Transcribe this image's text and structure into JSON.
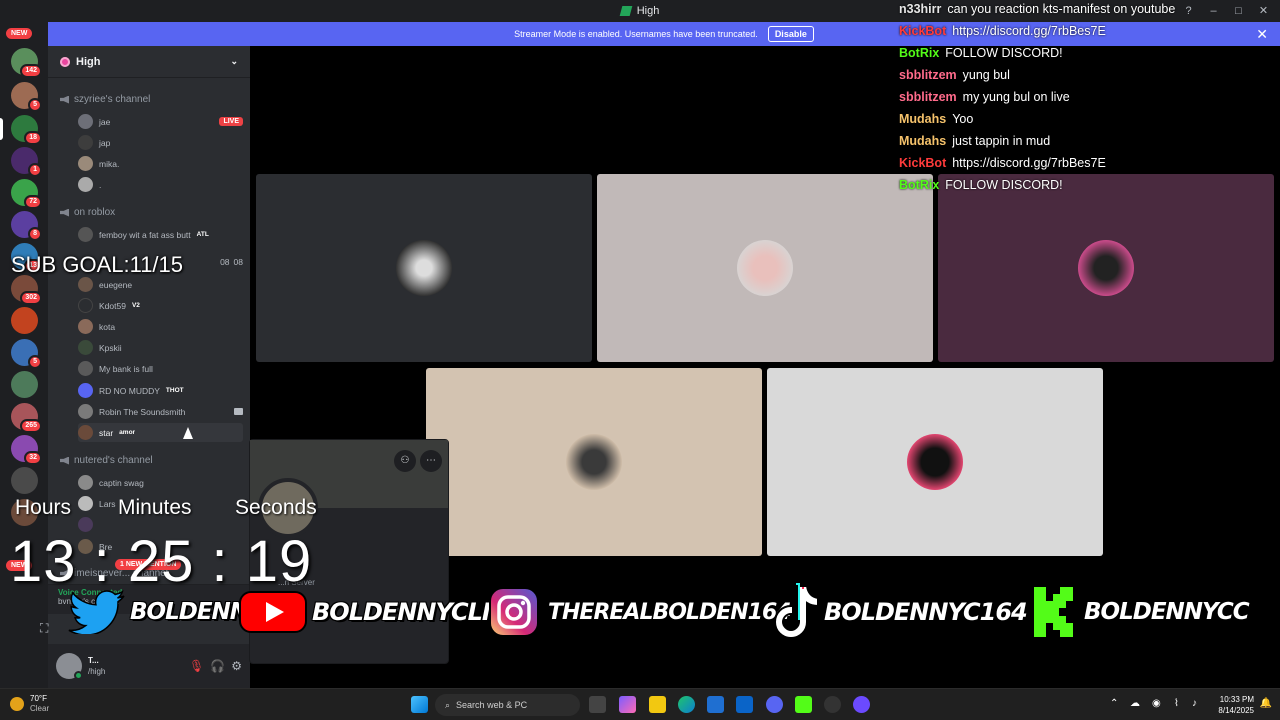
{
  "window": {
    "title": "High"
  },
  "banner": {
    "text": "Streamer Mode is enabled. Usernames have been truncated.",
    "button": "Disable"
  },
  "rail": {
    "new_top": "NEW",
    "badges": [
      "142",
      "5",
      "18",
      "1",
      "72",
      "8",
      "13",
      "302",
      "5",
      "265",
      "32"
    ],
    "new_bottom": "NEW",
    "mention": "1 NEW MENTION"
  },
  "server": {
    "name": "High"
  },
  "channels": {
    "c1": {
      "name": "szyriee's channel",
      "users": [
        "jae",
        "jap",
        "mika.",
        "."
      ],
      "live": "LIVE"
    },
    "c2": {
      "name": "on roblox",
      "users": [
        "femboy wit a fat ass butt"
      ],
      "tag": "ATL"
    },
    "c3": {
      "counts": [
        "08",
        "08"
      ],
      "users": [
        "euegene",
        "Kdot59",
        "kota",
        "Kpskii",
        "My bank is full",
        "RD NO MUDDY",
        "Robin The Soundsmith",
        "star"
      ],
      "tags": {
        "kdot": "V2",
        "rd": "THOT",
        "star": "amor"
      }
    },
    "c4": {
      "name": "nutered's channel",
      "users": [
        "captin swag",
        "Lars",
        "",
        "Bre"
      ]
    },
    "c5": {
      "name": "imeisnever... channel"
    }
  },
  "voice": {
    "status": "Voice Connected",
    "channel": "bvnnyy's chann..."
  },
  "user_panel": {
    "name": "T...",
    "status": "/high"
  },
  "overlay": {
    "sub_goal": "SUB GOAL:11/15",
    "timer_labels": {
      "h": "Hours",
      "m": "Minutes",
      "s": "Seconds"
    },
    "timer": "13 : 25 : 19",
    "socials": [
      "BOLDENNYC",
      "BOLDENNYCLIVE",
      "THEREALBOLDEN164",
      "BOLDENNYC164",
      "BOLDENNYCC"
    ]
  },
  "chat": [
    {
      "name": "n33hirr",
      "color": "#e6e6e6",
      "text": "can you reaction kts-manifest on youtube"
    },
    {
      "name": "KickBot",
      "color": "#ff3b3b",
      "text": "https://discord.gg/7rbBes7E"
    },
    {
      "name": "BotRix",
      "color": "#53fc18",
      "text": "FOLLOW DISCORD!"
    },
    {
      "name": "sbblitzem",
      "color": "#ff6b8b",
      "text": "yung bul"
    },
    {
      "name": "sbblitzem",
      "color": "#ff6b8b",
      "text": "my yung bul on live"
    },
    {
      "name": "Mudahs",
      "color": "#f5c26b",
      "text": "Yoo"
    },
    {
      "name": "Mudahs",
      "color": "#f5c26b",
      "text": "just tappin in mud"
    },
    {
      "name": "KickBot",
      "color": "#ff3b3b",
      "text": "https://discord.gg/7rbBes7E"
    },
    {
      "name": "BotRix",
      "color": "#53fc18",
      "text": "FOLLOW DISCORD!"
    }
  ],
  "card": {
    "server_label": "...n Server"
  },
  "taskbar": {
    "temp": "70°F",
    "cond": "Clear",
    "search": "Search web & PC",
    "time": "10:33 PM",
    "date": "8/14/2025"
  }
}
